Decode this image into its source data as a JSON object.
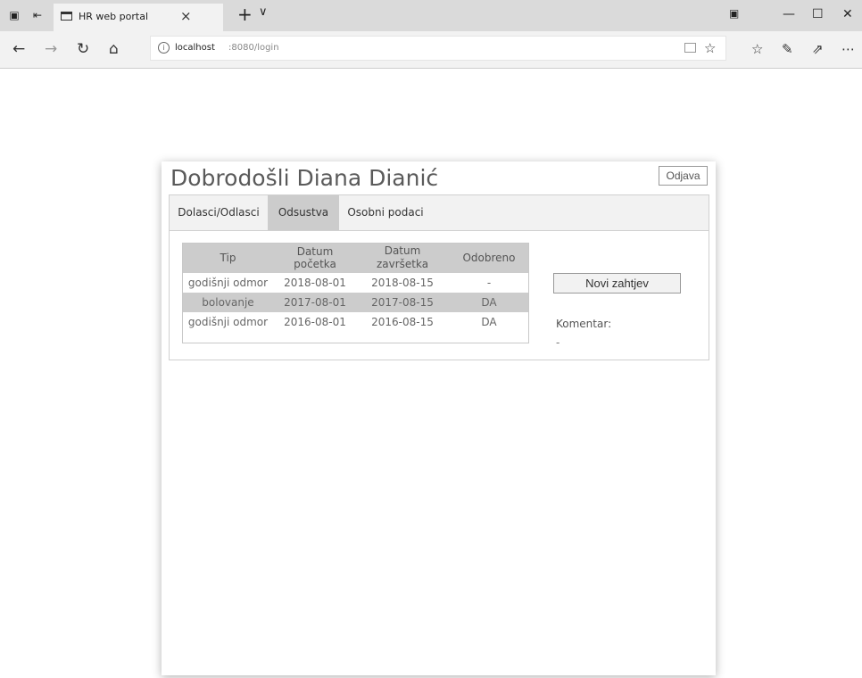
{
  "browser": {
    "tab_title": "HR web portal",
    "url_host": "localhost",
    "url_path": ":8080/login",
    "window_buttons": [
      "—",
      "☐",
      "✕"
    ]
  },
  "page": {
    "welcome": "Dobrodošli Diana Dianić",
    "logout_label": "Odjava",
    "tabs": [
      {
        "label": "Dolasci/Odlasci",
        "active": false
      },
      {
        "label": "Odsustva",
        "active": true
      },
      {
        "label": "Osobni podaci",
        "active": false
      }
    ],
    "table": {
      "headers": [
        "Tip",
        "Datum početka",
        "Datum završetka",
        "Odobreno"
      ],
      "rows": [
        [
          "godišnji odmor",
          "2018-08-01",
          "2018-08-15",
          "-"
        ],
        [
          "bolovanje",
          "2017-08-01",
          "2017-08-15",
          "DA"
        ],
        [
          "godišnji odmor",
          "2016-08-01",
          "2016-08-15",
          "DA"
        ]
      ]
    },
    "new_request_label": "Novi zahtjev",
    "comment_label": "Komentar:",
    "comment_value": "-"
  }
}
